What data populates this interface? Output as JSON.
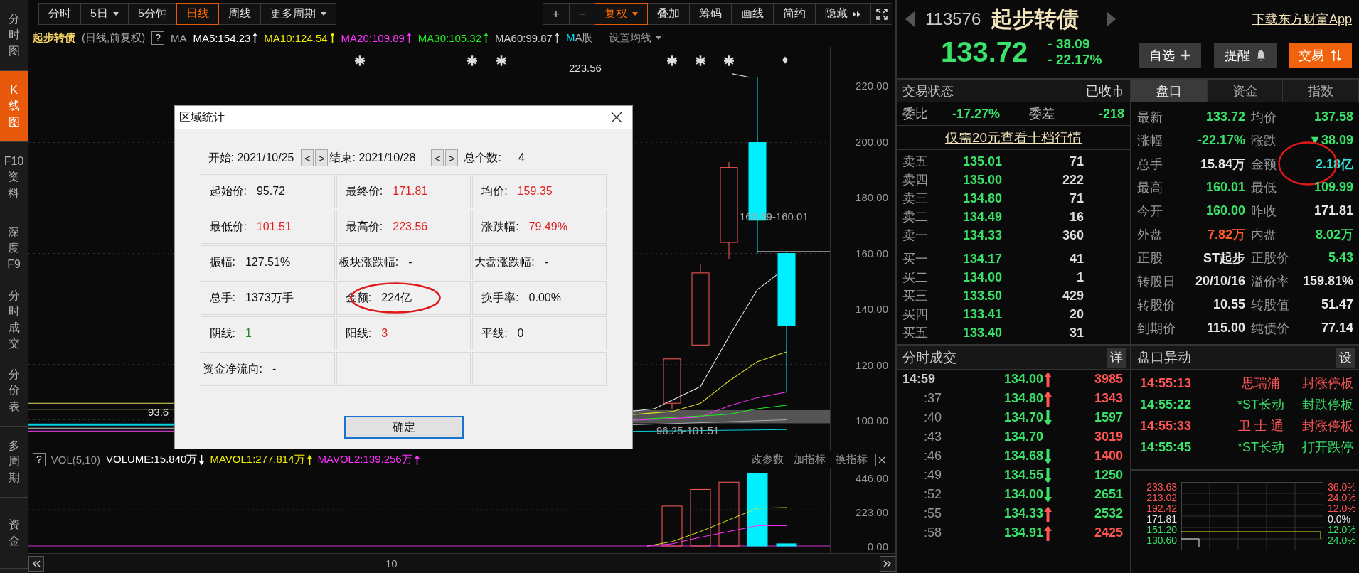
{
  "sidebar": {
    "items": [
      {
        "label": "分时图",
        "selected": false
      },
      {
        "label": "K线图",
        "selected": true
      },
      {
        "label": "F10资料",
        "selected": false
      },
      {
        "label": "深度F9",
        "selected": false
      },
      {
        "label": "分时成交",
        "selected": false
      },
      {
        "label": "分价表",
        "selected": false
      },
      {
        "label": "多周期",
        "selected": false
      },
      {
        "label": "资金",
        "selected": false
      }
    ]
  },
  "toolbar": {
    "periods": [
      {
        "label": "分时",
        "selected": false,
        "caret": false
      },
      {
        "label": "5日",
        "selected": false,
        "caret": true
      },
      {
        "label": "5分钟",
        "selected": false,
        "caret": false
      },
      {
        "label": "日线",
        "selected": true,
        "caret": false
      },
      {
        "label": "周线",
        "selected": false,
        "caret": false
      },
      {
        "label": "更多周期",
        "selected": false,
        "caret": true
      }
    ],
    "tools": [
      {
        "label": "+",
        "active": false,
        "caret": false
      },
      {
        "label": "−",
        "active": false,
        "caret": false
      },
      {
        "label": "复权",
        "active": true,
        "caret": true
      },
      {
        "label": "叠加",
        "active": false,
        "caret": false
      },
      {
        "label": "筹码",
        "active": false,
        "caret": false
      },
      {
        "label": "画线",
        "active": false,
        "caret": false
      },
      {
        "label": "简约",
        "active": false,
        "caret": false
      },
      {
        "label": "隐藏",
        "active": false,
        "caret": false,
        "kind": "expand"
      }
    ]
  },
  "legend": {
    "title": "起步转债",
    "subtitle": "(日线,前复权)",
    "help": "?",
    "ma_label": "MA",
    "ma": [
      {
        "label": "MA5:154.23",
        "color": "#ffffff",
        "rising": true
      },
      {
        "label": "MA10:124.54",
        "color": "#f0f000",
        "rising": true
      },
      {
        "label": "MA20:109.89",
        "color": "#ff33ff",
        "rising": true
      },
      {
        "label": "MA30:105.32",
        "color": "#22ee22",
        "rising": true
      },
      {
        "label": "MA60:99.87",
        "color": "#d0d0d0",
        "rising": true
      }
    ],
    "stock_ma": "MA股",
    "settings": "设置均线"
  },
  "price_chart": {
    "price_axis": [
      "220.00",
      "200.00",
      "180.00",
      "160.00",
      "140.00",
      "120.00",
      "100.00"
    ],
    "annotations": [
      "223.56",
      "160.69-160.01",
      "93.6",
      "96.25-101.51"
    ]
  },
  "volume": {
    "help": "?",
    "label": "VOL(5,10)",
    "items": [
      {
        "label": "VOLUME:15.840万",
        "color": "#ffffff",
        "rising": false
      },
      {
        "label": "MAVOL1:277.814万",
        "color": "#f0f000",
        "rising": true
      },
      {
        "label": "MAVOL2:139.256万",
        "color": "#ff33ff",
        "rising": true
      }
    ],
    "actions": [
      "改参数",
      "加指标",
      "换指标"
    ],
    "axis": [
      "446.00",
      "223.00",
      "0.00"
    ]
  },
  "x_axis_label": "10",
  "dialog": {
    "title": "区域统计",
    "start_label": "开始:",
    "start": "2021/10/25",
    "end_label": "结束:",
    "end": "2021/10/28",
    "prev": "<",
    "next": ">",
    "count_label": "总个数:",
    "count": "4",
    "rows": [
      [
        {
          "label": "起始价:",
          "value": "95.72",
          "color": "#111111"
        },
        {
          "label": "最终价:",
          "value": "171.81",
          "color": "#e02020"
        },
        {
          "label": "均价:",
          "value": "159.35",
          "color": "#e02020"
        }
      ],
      [
        {
          "label": "最低价:",
          "value": "101.51",
          "color": "#e02020"
        },
        {
          "label": "最高价:",
          "value": "223.56",
          "color": "#e02020"
        },
        {
          "label": "涨跌幅:",
          "value": "79.49%",
          "color": "#e02020"
        }
      ],
      [
        {
          "label": "振幅:",
          "value": "127.51%",
          "color": "#111111"
        },
        {
          "label": "板块涨跌幅:",
          "value": "-",
          "color": "#111111"
        },
        {
          "label": "大盘涨跌幅:",
          "value": "-",
          "color": "#111111"
        }
      ],
      [
        {
          "label": "总手:",
          "value": "1373万手",
          "color": "#111111"
        },
        {
          "label": "金额:",
          "value": "224亿",
          "color": "#111111",
          "circled": true
        },
        {
          "label": "换手率:",
          "value": "0.00%",
          "color": "#111111"
        }
      ],
      [
        {
          "label": "阴线:",
          "value": "1",
          "color": "#1f8a2a"
        },
        {
          "label": "阳线:",
          "value": "3",
          "color": "#e02020"
        },
        {
          "label": "平线:",
          "value": "0",
          "color": "#111111"
        }
      ],
      [
        {
          "label": "资金净流向:",
          "value": "-",
          "color": "#111111"
        }
      ]
    ],
    "ok": "确定"
  },
  "quote": {
    "code": "113576",
    "name": "起步转债",
    "price": "133.72",
    "change": "- 38.09",
    "change_pct": "- 22.17%",
    "app_link": "下载东方财富App",
    "buttons": [
      {
        "label": "自选",
        "kind": "plus"
      },
      {
        "label": "提醒",
        "kind": "bell"
      },
      {
        "label": "交易",
        "kind": "trade"
      }
    ]
  },
  "trade_status": {
    "label": "交易状态",
    "value": "已收市"
  },
  "order_ratio": {
    "label": "委比",
    "value": "-17.27%",
    "diff_label": "委差",
    "diff": "-218"
  },
  "ten_level_link": "仅需20元查看十档行情",
  "asks": [
    {
      "label": "卖五",
      "price": "135.01",
      "volume": "71"
    },
    {
      "label": "卖四",
      "price": "135.00",
      "volume": "222"
    },
    {
      "label": "卖三",
      "price": "134.80",
      "volume": "71"
    },
    {
      "label": "卖二",
      "price": "134.49",
      "volume": "16"
    },
    {
      "label": "卖一",
      "price": "134.33",
      "volume": "360"
    }
  ],
  "bids": [
    {
      "label": "买一",
      "price": "134.17",
      "volume": "41"
    },
    {
      "label": "买二",
      "price": "134.00",
      "volume": "1"
    },
    {
      "label": "买三",
      "price": "133.50",
      "volume": "429"
    },
    {
      "label": "买四",
      "price": "133.41",
      "volume": "20"
    },
    {
      "label": "买五",
      "price": "133.40",
      "volume": "31"
    }
  ],
  "tabs": [
    {
      "label": "盘口",
      "selected": true
    },
    {
      "label": "资金",
      "selected": false
    },
    {
      "label": "指数",
      "selected": false
    }
  ],
  "stats": [
    {
      "label": "最新",
      "value": "133.72",
      "color": "#3be26a"
    },
    {
      "label": "均价",
      "value": "137.58",
      "color": "#3be26a"
    },
    {
      "label": "涨幅",
      "value": "-22.17%",
      "color": "#3be26a"
    },
    {
      "label": "涨跌",
      "value": "▼38.09",
      "color": "#3be26a"
    },
    {
      "label": "总手",
      "value": "15.84万",
      "color": "#e8e8e8"
    },
    {
      "label": "金额",
      "value": "2.18亿",
      "color": "#35e0d0",
      "circled": true
    },
    {
      "label": "最高",
      "value": "160.01",
      "color": "#3be26a"
    },
    {
      "label": "最低",
      "value": "109.99",
      "color": "#3be26a"
    },
    {
      "label": "今开",
      "value": "160.00",
      "color": "#3be26a"
    },
    {
      "label": "昨收",
      "value": "171.81",
      "color": "#e8e8e8"
    },
    {
      "label": "外盘",
      "value": "7.82万",
      "color": "#ff5a2a"
    },
    {
      "label": "内盘",
      "value": "8.02万",
      "color": "#3be26a"
    },
    {
      "label": "正股",
      "value": "ST起步",
      "color": "#e8e8e8"
    },
    {
      "label": "正股价",
      "value": "5.43",
      "color": "#3be26a"
    },
    {
      "label": "转股日",
      "value": "20/10/16",
      "color": "#e8e8e8"
    },
    {
      "label": "溢价率",
      "value": "159.81%",
      "color": "#e8e8e8"
    },
    {
      "label": "转股价",
      "value": "10.55",
      "color": "#e8e8e8"
    },
    {
      "label": "转股值",
      "value": "51.47",
      "color": "#e8e8e8"
    },
    {
      "label": "到期价",
      "value": "115.00",
      "color": "#e8e8e8"
    },
    {
      "label": "纯债价",
      "value": "77.14",
      "color": "#e8e8e8"
    }
  ],
  "ticks": {
    "title": "分时成交",
    "detail": "详",
    "rows": [
      {
        "time": "14:59",
        "price": "134.00",
        "kind": "up",
        "volume": "3985",
        "color": "#ff5555"
      },
      {
        "time": ":37",
        "price": "134.80",
        "kind": "up",
        "volume": "1343",
        "color": "#ff5555"
      },
      {
        "time": ":40",
        "price": "134.70",
        "kind": "down",
        "volume": "1597",
        "color": "#3be26a"
      },
      {
        "time": ":43",
        "price": "134.70",
        "kind": "flat",
        "volume": "3019",
        "color": "#ff5555"
      },
      {
        "time": ":46",
        "price": "134.68",
        "kind": "down",
        "volume": "1400",
        "color": "#ff5555"
      },
      {
        "time": ":49",
        "price": "134.55",
        "kind": "down",
        "volume": "1250",
        "color": "#3be26a"
      },
      {
        "time": ":52",
        "price": "134.00",
        "kind": "down",
        "volume": "2651",
        "color": "#3be26a"
      },
      {
        "time": ":55",
        "price": "134.33",
        "kind": "up",
        "volume": "2532",
        "color": "#3be26a"
      },
      {
        "time": ":58",
        "price": "134.91",
        "kind": "up",
        "volume": "2425",
        "color": "#ff5555"
      }
    ]
  },
  "alerts": {
    "title": "盘口异动",
    "settings": "设",
    "rows": [
      {
        "time": "14:55:13",
        "name": "思瑞浦",
        "event": "封涨停板",
        "color": "#ff5555"
      },
      {
        "time": "14:55:22",
        "name": "*ST长动",
        "event": "封跌停板",
        "color": "#3be26a"
      },
      {
        "time": "14:55:33",
        "name": "卫 士 通",
        "event": "封涨停板",
        "color": "#ff5555"
      },
      {
        "time": "14:55:45",
        "name": "*ST长动",
        "event": "打开跌停",
        "color": "#3be26a"
      }
    ]
  },
  "mini_chart": {
    "left_axis": [
      {
        "label": "233.63",
        "color": "#ff5555"
      },
      {
        "label": "213.02",
        "color": "#ff5555"
      },
      {
        "label": "192.42",
        "color": "#ff5555"
      },
      {
        "label": "171.81",
        "color": "#e8e8e8"
      },
      {
        "label": "151.20",
        "color": "#3be26a"
      },
      {
        "label": "130.60",
        "color": "#3be26a"
      }
    ],
    "right_axis": [
      {
        "label": "36.0%",
        "color": "#ff5555"
      },
      {
        "label": "24.0%",
        "color": "#ff5555"
      },
      {
        "label": "12.0%",
        "color": "#ff5555"
      },
      {
        "label": "0.0%",
        "color": "#e8e8e8"
      },
      {
        "label": "12.0%",
        "color": "#3be26a"
      },
      {
        "label": "24.0%",
        "color": "#3be26a"
      }
    ]
  }
}
